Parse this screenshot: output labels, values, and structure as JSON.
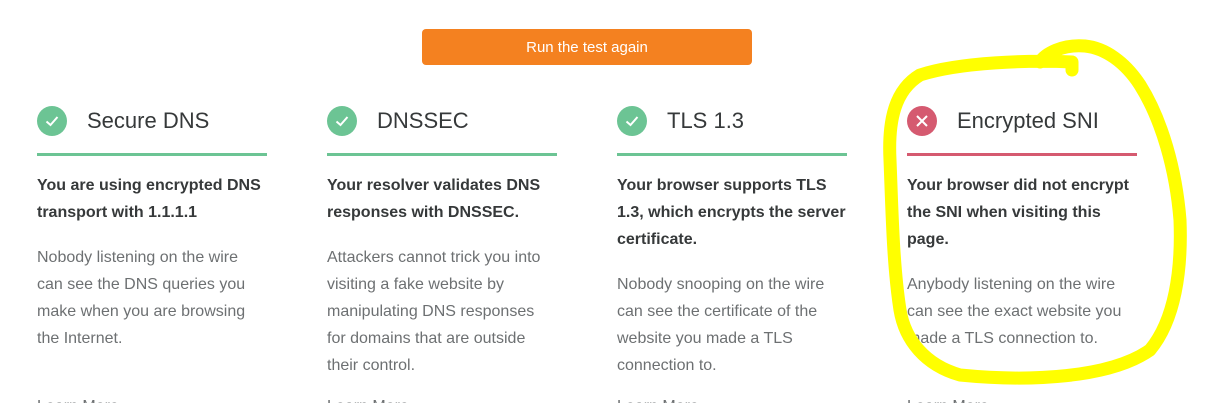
{
  "run_button": {
    "label": "Run the test again"
  },
  "columns": [
    {
      "title": "Secure DNS",
      "status": "pass",
      "lead": "You are using encrypted DNS transport with 1.1.1.1",
      "body": "Nobody listening on the wire can see the DNS queries you make when you are browsing the Internet.",
      "link": "Learn More"
    },
    {
      "title": "DNSSEC",
      "status": "pass",
      "lead": "Your resolver validates DNS responses with DNSSEC.",
      "body": "Attackers cannot trick you into visiting a fake website by manipulating DNS responses for domains that are outside their control.",
      "link": "Learn More"
    },
    {
      "title": "TLS 1.3",
      "status": "pass",
      "lead": "Your browser supports TLS 1.3, which encrypts the server certificate.",
      "body": "Nobody snooping on the wire can see the certificate of the website you made a TLS connection to.",
      "link": "Learn More"
    },
    {
      "title": "Encrypted SNI",
      "status": "fail",
      "lead": "Your browser did not encrypt the SNI when visiting this page.",
      "body": "Anybody listening on the wire can see the exact website you made a TLS connection to.",
      "link": "Learn More"
    }
  ],
  "colors": {
    "accent": "#f48120",
    "pass": "#6cc494",
    "fail": "#d55a70",
    "highlight": "#ffff00"
  },
  "icons": {
    "pass": "check-circle-icon",
    "fail": "x-circle-icon"
  }
}
